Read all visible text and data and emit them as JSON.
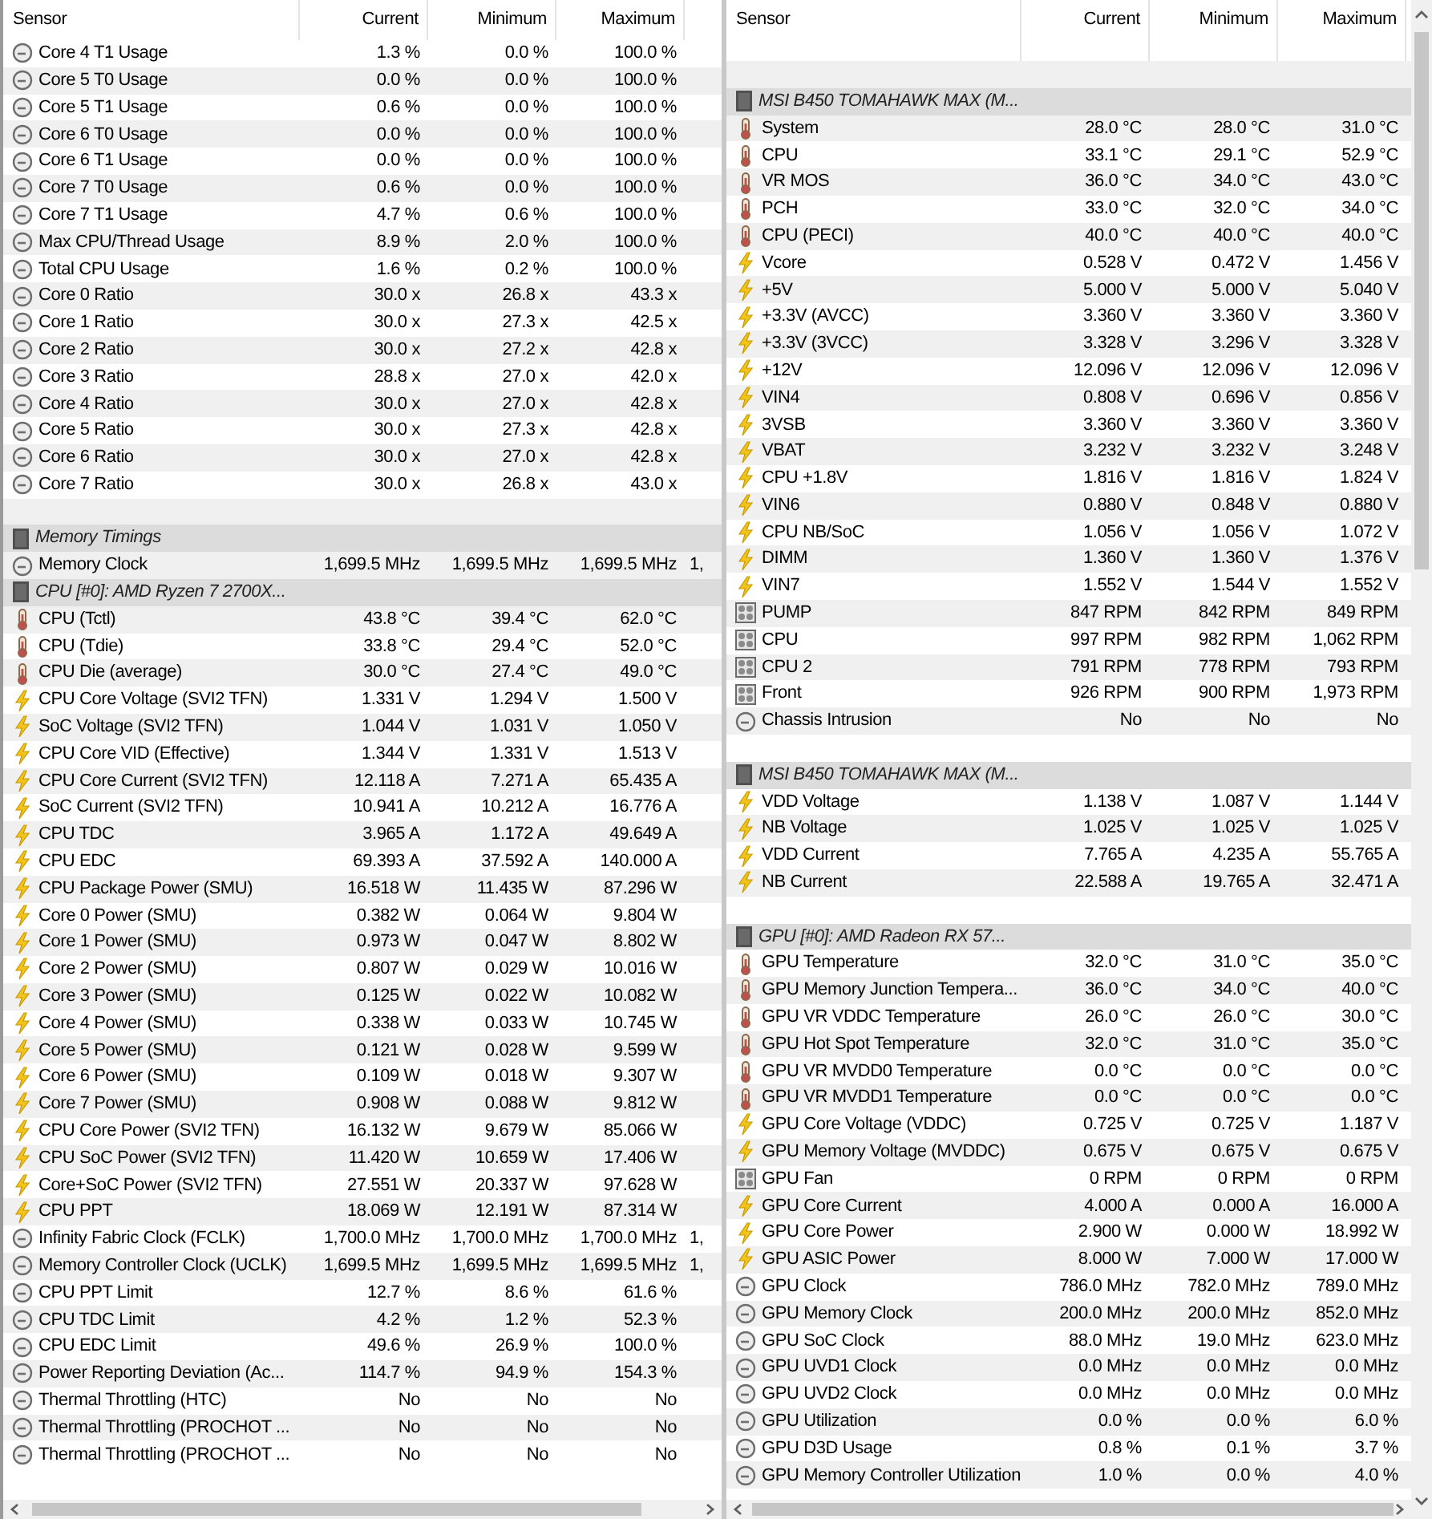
{
  "panels": [
    {
      "columns": [
        "Sensor",
        "Current",
        "Minimum",
        "Maximum"
      ],
      "rows": [
        {
          "kind": "clock",
          "sensor": "Core 4 T1 Usage",
          "current": "1.3 %",
          "minimum": "0.0 %",
          "maximum": "100.0 %"
        },
        {
          "kind": "clock",
          "sensor": "Core 5 T0 Usage",
          "current": "0.0 %",
          "minimum": "0.0 %",
          "maximum": "100.0 %"
        },
        {
          "kind": "clock",
          "sensor": "Core 5 T1 Usage",
          "current": "0.6 %",
          "minimum": "0.0 %",
          "maximum": "100.0 %"
        },
        {
          "kind": "clock",
          "sensor": "Core 6 T0 Usage",
          "current": "0.0 %",
          "minimum": "0.0 %",
          "maximum": "100.0 %"
        },
        {
          "kind": "clock",
          "sensor": "Core 6 T1 Usage",
          "current": "0.0 %",
          "minimum": "0.0 %",
          "maximum": "100.0 %"
        },
        {
          "kind": "clock",
          "sensor": "Core 7 T0 Usage",
          "current": "0.6 %",
          "minimum": "0.0 %",
          "maximum": "100.0 %"
        },
        {
          "kind": "clock",
          "sensor": "Core 7 T1 Usage",
          "current": "4.7 %",
          "minimum": "0.6 %",
          "maximum": "100.0 %"
        },
        {
          "kind": "clock",
          "sensor": "Max CPU/Thread Usage",
          "current": "8.9 %",
          "minimum": "2.0 %",
          "maximum": "100.0 %"
        },
        {
          "kind": "clock",
          "sensor": "Total CPU Usage",
          "current": "1.6 %",
          "minimum": "0.2 %",
          "maximum": "100.0 %"
        },
        {
          "kind": "clock",
          "sensor": "Core 0 Ratio",
          "current": "30.0 x",
          "minimum": "26.8 x",
          "maximum": "43.3 x"
        },
        {
          "kind": "clock",
          "sensor": "Core 1 Ratio",
          "current": "30.0 x",
          "minimum": "27.3 x",
          "maximum": "42.5 x"
        },
        {
          "kind": "clock",
          "sensor": "Core 2 Ratio",
          "current": "30.0 x",
          "minimum": "27.2 x",
          "maximum": "42.8 x"
        },
        {
          "kind": "clock",
          "sensor": "Core 3 Ratio",
          "current": "28.8 x",
          "minimum": "27.0 x",
          "maximum": "42.0 x"
        },
        {
          "kind": "clock",
          "sensor": "Core 4 Ratio",
          "current": "30.0 x",
          "minimum": "27.0 x",
          "maximum": "42.8 x"
        },
        {
          "kind": "clock",
          "sensor": "Core 5 Ratio",
          "current": "30.0 x",
          "minimum": "27.3 x",
          "maximum": "42.8 x"
        },
        {
          "kind": "clock",
          "sensor": "Core 6 Ratio",
          "current": "30.0 x",
          "minimum": "27.0 x",
          "maximum": "42.8 x"
        },
        {
          "kind": "clock",
          "sensor": "Core 7 Ratio",
          "current": "30.0 x",
          "minimum": "26.8 x",
          "maximum": "43.0 x"
        },
        {
          "kind": "blank"
        },
        {
          "kind": "group",
          "sensor": "Memory Timings"
        },
        {
          "kind": "clock",
          "sensor": "Memory Clock",
          "current": "1,699.5 MHz",
          "minimum": "1,699.5 MHz",
          "maximum": "1,699.5 MHz",
          "column_5": "1,"
        },
        {
          "kind": "group",
          "sensor": "CPU [#0]: AMD Ryzen 7 2700X..."
        },
        {
          "kind": "temp",
          "sensor": "CPU (Tctl)",
          "current": "43.8 °C",
          "minimum": "39.4 °C",
          "maximum": "62.0 °C"
        },
        {
          "kind": "temp",
          "sensor": "CPU (Tdie)",
          "current": "33.8 °C",
          "minimum": "29.4 °C",
          "maximum": "52.0 °C"
        },
        {
          "kind": "temp",
          "sensor": "CPU Die (average)",
          "current": "30.0 °C",
          "minimum": "27.4 °C",
          "maximum": "49.0 °C"
        },
        {
          "kind": "volt",
          "sensor": "CPU Core Voltage (SVI2 TFN)",
          "current": "1.331 V",
          "minimum": "1.294 V",
          "maximum": "1.500 V"
        },
        {
          "kind": "volt",
          "sensor": "SoC Voltage (SVI2 TFN)",
          "current": "1.044 V",
          "minimum": "1.031 V",
          "maximum": "1.050 V"
        },
        {
          "kind": "volt",
          "sensor": "CPU Core VID (Effective)",
          "current": "1.344 V",
          "minimum": "1.331 V",
          "maximum": "1.513 V"
        },
        {
          "kind": "volt",
          "sensor": "CPU Core Current (SVI2 TFN)",
          "current": "12.118 A",
          "minimum": "7.271 A",
          "maximum": "65.435 A"
        },
        {
          "kind": "volt",
          "sensor": "SoC Current (SVI2 TFN)",
          "current": "10.941 A",
          "minimum": "10.212 A",
          "maximum": "16.776 A"
        },
        {
          "kind": "volt",
          "sensor": "CPU TDC",
          "current": "3.965 A",
          "minimum": "1.172 A",
          "maximum": "49.649 A"
        },
        {
          "kind": "volt",
          "sensor": "CPU EDC",
          "current": "69.393 A",
          "minimum": "37.592 A",
          "maximum": "140.000 A"
        },
        {
          "kind": "volt",
          "sensor": "CPU Package Power (SMU)",
          "current": "16.518 W",
          "minimum": "11.435 W",
          "maximum": "87.296 W"
        },
        {
          "kind": "volt",
          "sensor": "Core 0 Power (SMU)",
          "current": "0.382 W",
          "minimum": "0.064 W",
          "maximum": "9.804 W"
        },
        {
          "kind": "volt",
          "sensor": "Core 1 Power (SMU)",
          "current": "0.973 W",
          "minimum": "0.047 W",
          "maximum": "8.802 W"
        },
        {
          "kind": "volt",
          "sensor": "Core 2 Power (SMU)",
          "current": "0.807 W",
          "minimum": "0.029 W",
          "maximum": "10.016 W"
        },
        {
          "kind": "volt",
          "sensor": "Core 3 Power (SMU)",
          "current": "0.125 W",
          "minimum": "0.022 W",
          "maximum": "10.082 W"
        },
        {
          "kind": "volt",
          "sensor": "Core 4 Power (SMU)",
          "current": "0.338 W",
          "minimum": "0.033 W",
          "maximum": "10.745 W"
        },
        {
          "kind": "volt",
          "sensor": "Core 5 Power (SMU)",
          "current": "0.121 W",
          "minimum": "0.028 W",
          "maximum": "9.599 W"
        },
        {
          "kind": "volt",
          "sensor": "Core 6 Power (SMU)",
          "current": "0.109 W",
          "minimum": "0.018 W",
          "maximum": "9.307 W"
        },
        {
          "kind": "volt",
          "sensor": "Core 7 Power (SMU)",
          "current": "0.908 W",
          "minimum": "0.088 W",
          "maximum": "9.812 W"
        },
        {
          "kind": "volt",
          "sensor": "CPU Core Power (SVI2 TFN)",
          "current": "16.132 W",
          "minimum": "9.679 W",
          "maximum": "85.066 W"
        },
        {
          "kind": "volt",
          "sensor": "CPU SoC Power (SVI2 TFN)",
          "current": "11.420 W",
          "minimum": "10.659 W",
          "maximum": "17.406 W"
        },
        {
          "kind": "volt",
          "sensor": "Core+SoC Power (SVI2 TFN)",
          "current": "27.551 W",
          "minimum": "20.337 W",
          "maximum": "97.628 W"
        },
        {
          "kind": "volt",
          "sensor": "CPU PPT",
          "current": "18.069 W",
          "minimum": "12.191 W",
          "maximum": "87.314 W"
        },
        {
          "kind": "clock",
          "sensor": "Infinity Fabric Clock (FCLK)",
          "current": "1,700.0 MHz",
          "minimum": "1,700.0 MHz",
          "maximum": "1,700.0 MHz",
          "column_5": "1,"
        },
        {
          "kind": "clock",
          "sensor": "Memory Controller Clock (UCLK)",
          "current": "1,699.5 MHz",
          "minimum": "1,699.5 MHz",
          "maximum": "1,699.5 MHz",
          "column_5": "1,"
        },
        {
          "kind": "clock",
          "sensor": "CPU PPT Limit",
          "current": "12.7 %",
          "minimum": "8.6 %",
          "maximum": "61.6 %"
        },
        {
          "kind": "clock",
          "sensor": "CPU TDC Limit",
          "current": "4.2 %",
          "minimum": "1.2 %",
          "maximum": "52.3 %"
        },
        {
          "kind": "clock",
          "sensor": "CPU EDC Limit",
          "current": "49.6 %",
          "minimum": "26.9 %",
          "maximum": "100.0 %"
        },
        {
          "kind": "clock",
          "sensor": "Power Reporting Deviation (Ac...",
          "current": "114.7 %",
          "minimum": "94.9 %",
          "maximum": "154.3 %"
        },
        {
          "kind": "clock",
          "sensor": "Thermal Throttling (HTC)",
          "current": "No",
          "minimum": "No",
          "maximum": "No"
        },
        {
          "kind": "clock",
          "sensor": "Thermal Throttling (PROCHOT ...",
          "current": "No",
          "minimum": "No",
          "maximum": "No"
        },
        {
          "kind": "clock",
          "sensor": "Thermal Throttling (PROCHOT ...",
          "current": "No",
          "minimum": "No",
          "maximum": "No"
        }
      ]
    },
    {
      "columns": [
        "Sensor",
        "Current",
        "Minimum",
        "Maximum"
      ],
      "rows": [
        {
          "kind": "blank"
        },
        {
          "kind": "group",
          "sensor": "MSI B450 TOMAHAWK MAX (M..."
        },
        {
          "kind": "temp",
          "sensor": "System",
          "current": "28.0 °C",
          "minimum": "28.0 °C",
          "maximum": "31.0 °C"
        },
        {
          "kind": "temp",
          "sensor": "CPU",
          "current": "33.1 °C",
          "minimum": "29.1 °C",
          "maximum": "52.9 °C"
        },
        {
          "kind": "temp",
          "sensor": "VR MOS",
          "current": "36.0 °C",
          "minimum": "34.0 °C",
          "maximum": "43.0 °C"
        },
        {
          "kind": "temp",
          "sensor": "PCH",
          "current": "33.0 °C",
          "minimum": "32.0 °C",
          "maximum": "34.0 °C"
        },
        {
          "kind": "temp",
          "sensor": "CPU (PECI)",
          "current": "40.0 °C",
          "minimum": "40.0 °C",
          "maximum": "40.0 °C"
        },
        {
          "kind": "volt",
          "sensor": "Vcore",
          "current": "0.528 V",
          "minimum": "0.472 V",
          "maximum": "1.456 V"
        },
        {
          "kind": "volt",
          "sensor": "+5V",
          "current": "5.000 V",
          "minimum": "5.000 V",
          "maximum": "5.040 V"
        },
        {
          "kind": "volt",
          "sensor": "+3.3V (AVCC)",
          "current": "3.360 V",
          "minimum": "3.360 V",
          "maximum": "3.360 V"
        },
        {
          "kind": "volt",
          "sensor": "+3.3V (3VCC)",
          "current": "3.328 V",
          "minimum": "3.296 V",
          "maximum": "3.328 V"
        },
        {
          "kind": "volt",
          "sensor": "+12V",
          "current": "12.096 V",
          "minimum": "12.096 V",
          "maximum": "12.096 V"
        },
        {
          "kind": "volt",
          "sensor": "VIN4",
          "current": "0.808 V",
          "minimum": "0.696 V",
          "maximum": "0.856 V"
        },
        {
          "kind": "volt",
          "sensor": "3VSB",
          "current": "3.360 V",
          "minimum": "3.360 V",
          "maximum": "3.360 V"
        },
        {
          "kind": "volt",
          "sensor": "VBAT",
          "current": "3.232 V",
          "minimum": "3.232 V",
          "maximum": "3.248 V"
        },
        {
          "kind": "volt",
          "sensor": "CPU +1.8V",
          "current": "1.816 V",
          "minimum": "1.816 V",
          "maximum": "1.824 V"
        },
        {
          "kind": "volt",
          "sensor": "VIN6",
          "current": "0.880 V",
          "minimum": "0.848 V",
          "maximum": "0.880 V"
        },
        {
          "kind": "volt",
          "sensor": "CPU NB/SoC",
          "current": "1.056 V",
          "minimum": "1.056 V",
          "maximum": "1.072 V"
        },
        {
          "kind": "volt",
          "sensor": "DIMM",
          "current": "1.360 V",
          "minimum": "1.360 V",
          "maximum": "1.376 V"
        },
        {
          "kind": "volt",
          "sensor": "VIN7",
          "current": "1.552 V",
          "minimum": "1.544 V",
          "maximum": "1.552 V"
        },
        {
          "kind": "fan",
          "sensor": "PUMP",
          "current": "847 RPM",
          "minimum": "842 RPM",
          "maximum": "849 RPM"
        },
        {
          "kind": "fan",
          "sensor": "CPU",
          "current": "997 RPM",
          "minimum": "982 RPM",
          "maximum": "1,062 RPM"
        },
        {
          "kind": "fan",
          "sensor": "CPU 2",
          "current": "791 RPM",
          "minimum": "778 RPM",
          "maximum": "793 RPM"
        },
        {
          "kind": "fan",
          "sensor": "Front",
          "current": "926 RPM",
          "minimum": "900 RPM",
          "maximum": "1,973 RPM"
        },
        {
          "kind": "clock",
          "sensor": "Chassis Intrusion",
          "current": "No",
          "minimum": "No",
          "maximum": "No"
        },
        {
          "kind": "blank"
        },
        {
          "kind": "group",
          "sensor": "MSI B450 TOMAHAWK MAX (M..."
        },
        {
          "kind": "volt",
          "sensor": "VDD Voltage",
          "current": "1.138 V",
          "minimum": "1.087 V",
          "maximum": "1.144 V"
        },
        {
          "kind": "volt",
          "sensor": "NB Voltage",
          "current": "1.025 V",
          "minimum": "1.025 V",
          "maximum": "1.025 V"
        },
        {
          "kind": "volt",
          "sensor": "VDD Current",
          "current": "7.765 A",
          "minimum": "4.235 A",
          "maximum": "55.765 A"
        },
        {
          "kind": "volt",
          "sensor": "NB Current",
          "current": "22.588 A",
          "minimum": "19.765 A",
          "maximum": "32.471 A"
        },
        {
          "kind": "blank"
        },
        {
          "kind": "group",
          "sensor": "GPU [#0]: AMD Radeon RX 57..."
        },
        {
          "kind": "temp",
          "sensor": "GPU Temperature",
          "current": "32.0 °C",
          "minimum": "31.0 °C",
          "maximum": "35.0 °C"
        },
        {
          "kind": "temp",
          "sensor": "GPU Memory Junction Tempera...",
          "current": "36.0 °C",
          "minimum": "34.0 °C",
          "maximum": "40.0 °C"
        },
        {
          "kind": "temp",
          "sensor": "GPU VR VDDC Temperature",
          "current": "26.0 °C",
          "minimum": "26.0 °C",
          "maximum": "30.0 °C"
        },
        {
          "kind": "temp",
          "sensor": "GPU Hot Spot Temperature",
          "current": "32.0 °C",
          "minimum": "31.0 °C",
          "maximum": "35.0 °C"
        },
        {
          "kind": "temp",
          "sensor": "GPU VR MVDD0 Temperature",
          "current": "0.0 °C",
          "minimum": "0.0 °C",
          "maximum": "0.0 °C"
        },
        {
          "kind": "temp",
          "sensor": "GPU VR MVDD1 Temperature",
          "current": "0.0 °C",
          "minimum": "0.0 °C",
          "maximum": "0.0 °C"
        },
        {
          "kind": "volt",
          "sensor": "GPU Core Voltage (VDDC)",
          "current": "0.725 V",
          "minimum": "0.725 V",
          "maximum": "1.187 V"
        },
        {
          "kind": "volt",
          "sensor": "GPU Memory Voltage (MVDDC)",
          "current": "0.675 V",
          "minimum": "0.675 V",
          "maximum": "0.675 V"
        },
        {
          "kind": "fan",
          "sensor": "GPU Fan",
          "current": "0 RPM",
          "minimum": "0 RPM",
          "maximum": "0 RPM"
        },
        {
          "kind": "volt",
          "sensor": "GPU Core Current",
          "current": "4.000 A",
          "minimum": "0.000 A",
          "maximum": "16.000 A"
        },
        {
          "kind": "volt",
          "sensor": "GPU Core Power",
          "current": "2.900 W",
          "minimum": "0.000 W",
          "maximum": "18.992 W"
        },
        {
          "kind": "volt",
          "sensor": "GPU ASIC Power",
          "current": "8.000 W",
          "minimum": "7.000 W",
          "maximum": "17.000 W"
        },
        {
          "kind": "clock",
          "sensor": "GPU Clock",
          "current": "786.0 MHz",
          "minimum": "782.0 MHz",
          "maximum": "789.0 MHz"
        },
        {
          "kind": "clock",
          "sensor": "GPU Memory Clock",
          "current": "200.0 MHz",
          "minimum": "200.0 MHz",
          "maximum": "852.0 MHz"
        },
        {
          "kind": "clock",
          "sensor": "GPU SoC Clock",
          "current": "88.0 MHz",
          "minimum": "19.0 MHz",
          "maximum": "623.0 MHz"
        },
        {
          "kind": "clock",
          "sensor": "GPU UVD1 Clock",
          "current": "0.0 MHz",
          "minimum": "0.0 MHz",
          "maximum": "0.0 MHz"
        },
        {
          "kind": "clock",
          "sensor": "GPU UVD2 Clock",
          "current": "0.0 MHz",
          "minimum": "0.0 MHz",
          "maximum": "0.0 MHz"
        },
        {
          "kind": "clock",
          "sensor": "GPU Utilization",
          "current": "0.0 %",
          "minimum": "0.0 %",
          "maximum": "6.0 %"
        },
        {
          "kind": "clock",
          "sensor": "GPU D3D Usage",
          "current": "0.8 %",
          "minimum": "0.1 %",
          "maximum": "3.7 %"
        },
        {
          "kind": "clock",
          "sensor": "GPU Memory Controller Utilization",
          "current": "1.0 %",
          "minimum": "0.0 %",
          "maximum": "4.0 %"
        }
      ]
    }
  ]
}
